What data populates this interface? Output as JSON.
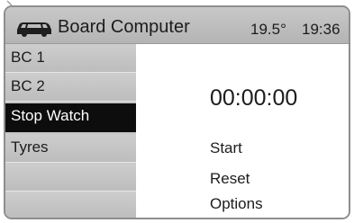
{
  "header": {
    "title": "Board Computer",
    "temperature": "19.5°",
    "time": "19:36",
    "icon": "car-icon"
  },
  "sidebar": {
    "items": [
      {
        "label": "BC 1"
      },
      {
        "label": "BC 2"
      },
      {
        "label": "Stop Watch",
        "selected": true
      },
      {
        "label": "Tyres"
      },
      {
        "label": ""
      },
      {
        "label": ""
      }
    ]
  },
  "main": {
    "timer": "00:00:00",
    "actions": [
      {
        "label": "Start"
      },
      {
        "label": "Reset"
      },
      {
        "label": "Options"
      }
    ]
  },
  "colors": {
    "header_bg": "#bdbdbd",
    "sidebar_bg": "#c4c4c4",
    "selected_bg": "#0d0d0d",
    "selected_text": "#ffffff",
    "content_bg": "#ffffff"
  }
}
